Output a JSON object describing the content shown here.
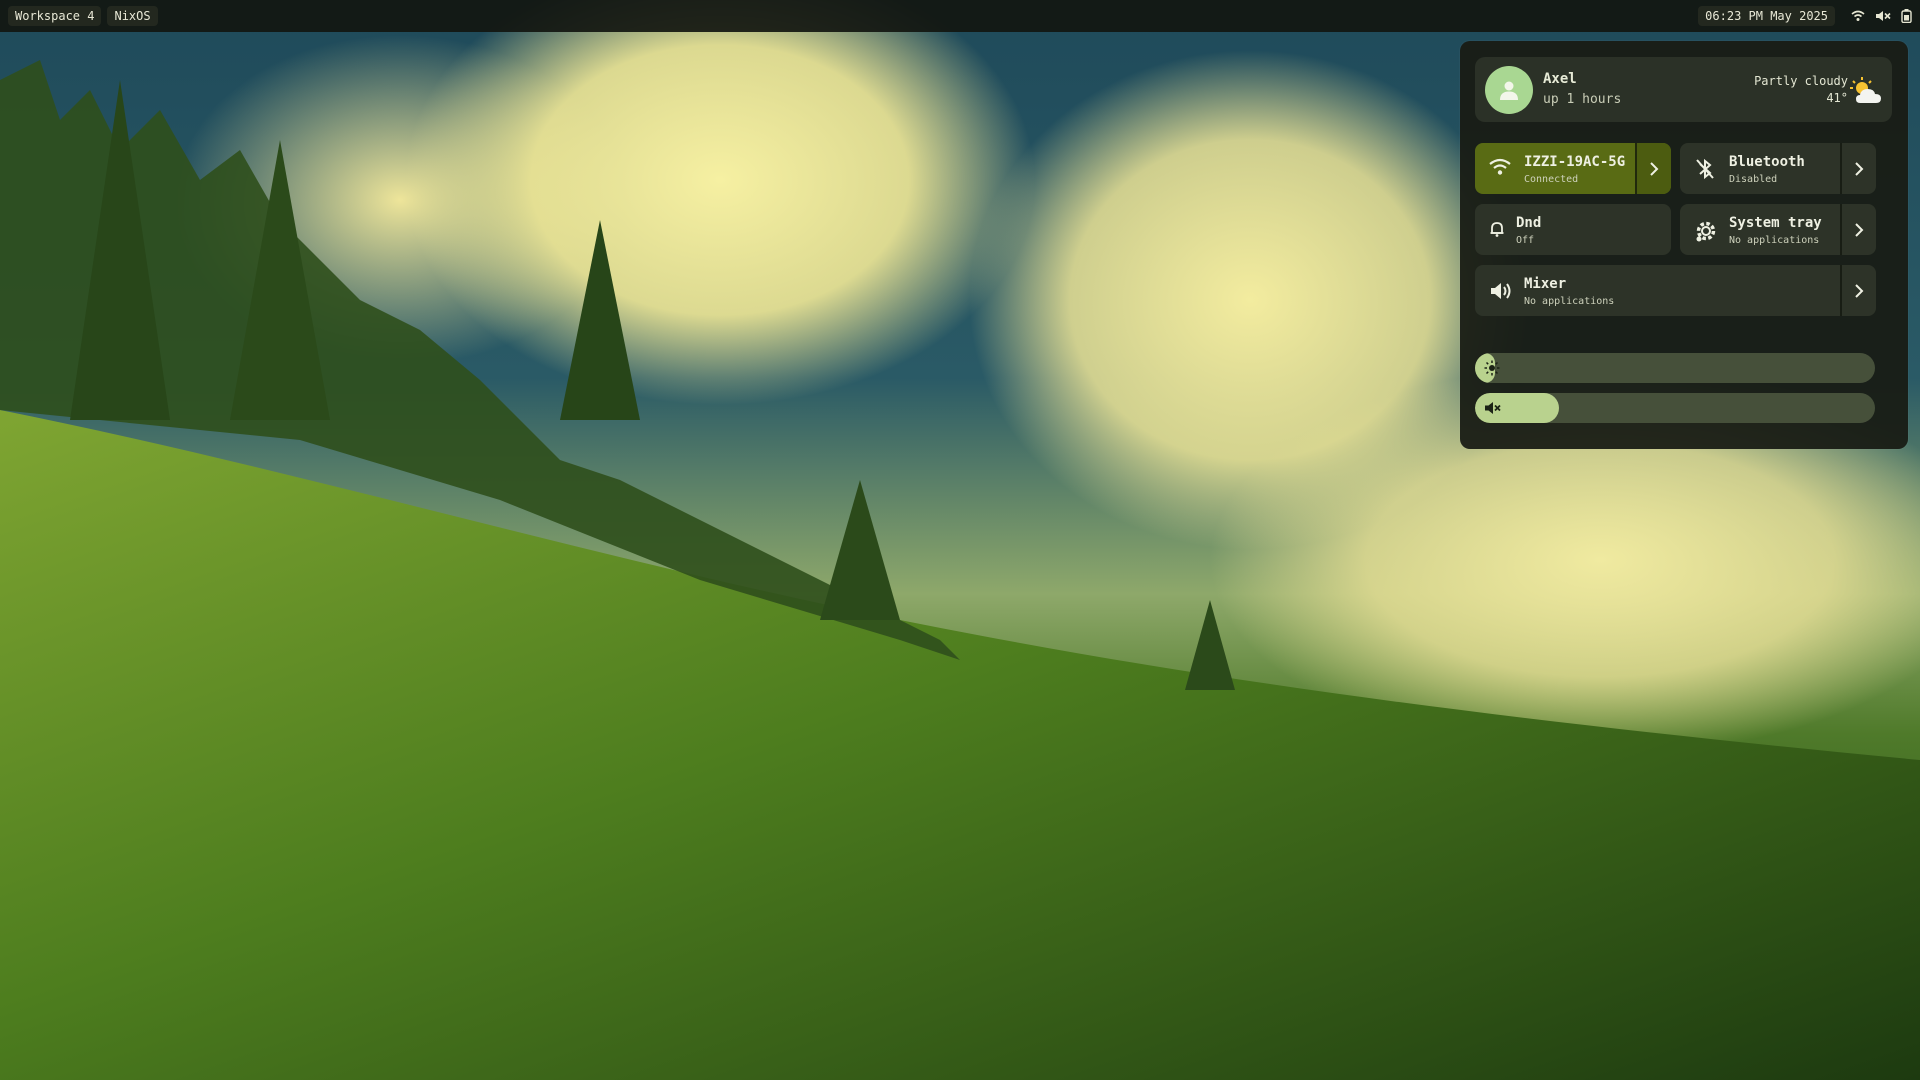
{
  "topbar": {
    "workspace": "Workspace 4",
    "distro": "NixOS",
    "datetime": "06:23 PM May 2025"
  },
  "profile": {
    "name": "Axel",
    "uptime": "up 1 hours",
    "weather_desc": "Partly cloudy",
    "weather_temp": "41°",
    "weather_icon": "partly-cloudy-icon"
  },
  "tiles": {
    "wifi": {
      "title": "IZZI-19AC-5G",
      "subtitle": "Connected",
      "icon": "wifi-icon",
      "active": true
    },
    "bluetooth": {
      "title": "Bluetooth",
      "subtitle": "Disabled",
      "icon": "bluetooth-off-icon",
      "active": false
    },
    "dnd": {
      "title": "Dnd",
      "subtitle": "Off",
      "icon": "bell-icon",
      "active": false
    },
    "tray": {
      "title": "System tray",
      "subtitle": "No applications",
      "icon": "gear-icon",
      "active": false
    },
    "mixer": {
      "title": "Mixer",
      "subtitle": "No applications",
      "icon": "speaker-icon",
      "active": false
    }
  },
  "sliders": {
    "brightness": {
      "icon": "brightness-icon",
      "level": 0.02
    },
    "volume": {
      "icon": "volume-muted-icon",
      "level": 0.21
    }
  },
  "colors": {
    "panel_bg": "#181c14",
    "tile_bg": "#2d3328",
    "tile_active": "#596b14",
    "slider_fill": "#b9d28e",
    "avatar": "#a9d792"
  }
}
